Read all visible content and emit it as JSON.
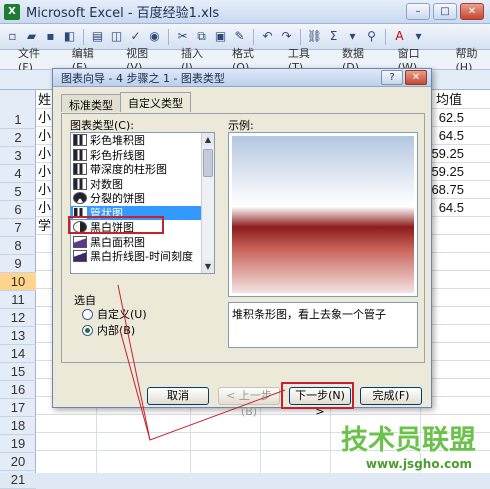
{
  "window": {
    "title": "Microsoft Excel - 百度经验1.xls",
    "app_icon": "X"
  },
  "toolbar": {
    "sigma": "Σ"
  },
  "menu": [
    "文件(F)",
    "编辑(E)",
    "视图(V)",
    "插入(I)",
    "格式(O)",
    "工具(T)",
    "数据(D)",
    "窗口(W)",
    "帮助(H)"
  ],
  "rows": [
    "1",
    "2",
    "3",
    "4",
    "5",
    "6",
    "7",
    "8",
    "9",
    "10",
    "11",
    "12",
    "13",
    "14",
    "15",
    "16",
    "17",
    "18",
    "19",
    "20",
    "21"
  ],
  "cells": {
    "a1": "姓",
    "a2": "小",
    "a3": "小",
    "a4": "小",
    "a5": "小",
    "a6": "小",
    "a7": "小",
    "a8": "学",
    "f1": "均值",
    "f2": "62.5",
    "f3": "64.5",
    "f4": "59.25",
    "f5": "59.25",
    "f6": "68.75",
    "f7": "64.5"
  },
  "dialog": {
    "title": "图表向导 - 4 步骤之 1 - 图表类型",
    "help_btn": "?",
    "close_btn": "✕",
    "tabs": [
      "标准类型",
      "自定义类型"
    ],
    "chart_type_label": "图表类型(C):",
    "preview_label": "示例:",
    "chart_types": [
      "彩色堆积图",
      "彩色折线图",
      "带深度的柱形图",
      "对数图",
      "分裂的饼图",
      "管状图",
      "黑白饼图",
      "黑白面积图",
      "黑白折线图-时间刻度"
    ],
    "selected_index": 5,
    "description": "堆积条形图，看上去象一个管子",
    "source_label": "选自",
    "radio_custom": "自定义(U)",
    "radio_builtin": "内部(B)",
    "buttons": {
      "cancel": "取消",
      "back": "< 上一步(B)",
      "next": "下一步(N) >",
      "finish": "完成(F)"
    }
  },
  "watermark": {
    "text": "技术员联盟",
    "url": "www.jsgho.com"
  }
}
